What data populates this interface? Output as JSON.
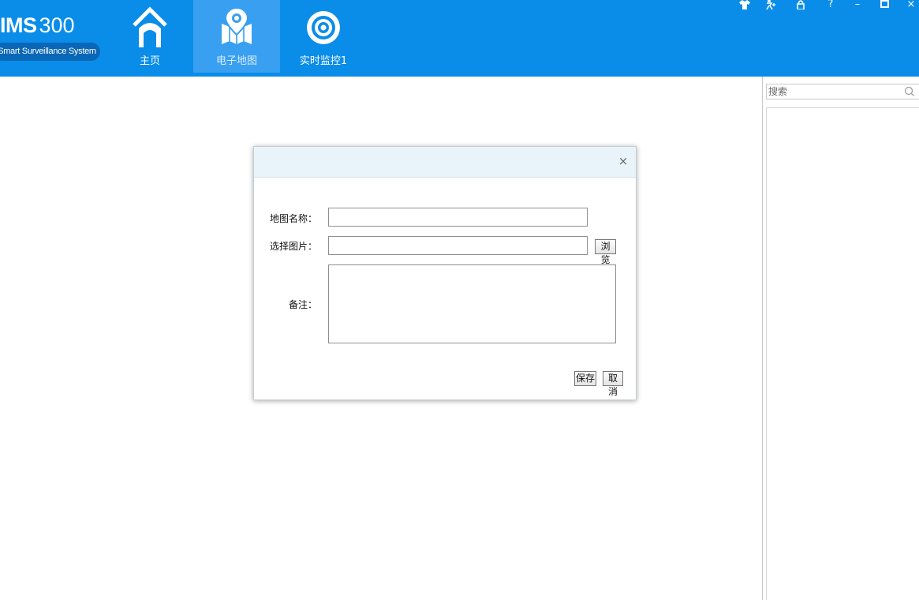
{
  "app": {
    "logo_title": "IMS",
    "logo_number": "300",
    "logo_subtitle": "Smart Surveillance System"
  },
  "nav": {
    "tabs": [
      {
        "label": "主页",
        "icon": "home-icon",
        "active": false
      },
      {
        "label": "电子地图",
        "icon": "map-icon",
        "active": true
      },
      {
        "label": "实时监控1",
        "icon": "monitor-target-icon",
        "active": false
      }
    ]
  },
  "window_controls": {
    "skin": "shirt-icon",
    "user": "user-switch-icon",
    "lock": "lock-icon",
    "help": "?",
    "minimize": "–",
    "maximize": "□",
    "close": "×"
  },
  "sidebar": {
    "search_placeholder": "搜索"
  },
  "dialog": {
    "close": "×",
    "map_name_label": "地图名称：",
    "map_name_value": "",
    "image_label": "选择图片：",
    "image_value": "",
    "browse_button": "浏览",
    "remark_label": "备注：",
    "remark_value": "",
    "save_button": "保存",
    "cancel_button": "取消"
  },
  "colors": {
    "topbar": "#0a8de9",
    "active_tab": "#399ff0",
    "dialog_header": "#e8f3fa"
  }
}
